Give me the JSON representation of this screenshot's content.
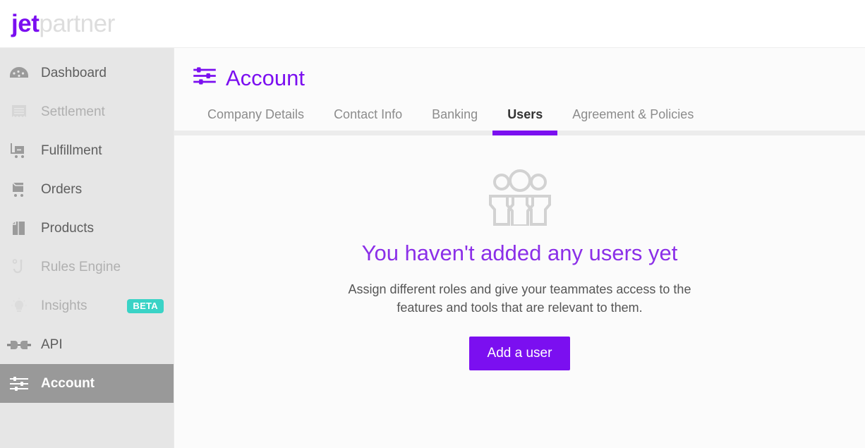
{
  "brand": {
    "logo_primary": "jet",
    "logo_secondary": "partner",
    "primary_color": "#7b0ff0",
    "secondary_color": "#dddddd"
  },
  "sidebar": {
    "background_color": "#e6e6e6",
    "active_color": "#999999",
    "items": [
      {
        "label": "Dashboard",
        "icon": "gauge-icon",
        "state": "normal",
        "badge": null
      },
      {
        "label": "Settlement",
        "icon": "receipt-icon",
        "state": "disabled",
        "badge": null
      },
      {
        "label": "Fulfillment",
        "icon": "cart-out-icon",
        "state": "normal",
        "badge": null
      },
      {
        "label": "Orders",
        "icon": "cart-icon",
        "state": "normal",
        "badge": null
      },
      {
        "label": "Products",
        "icon": "box-icon",
        "state": "normal",
        "badge": null
      },
      {
        "label": "Rules Engine",
        "icon": "rules-icon",
        "state": "disabled",
        "badge": null
      },
      {
        "label": "Insights",
        "icon": "lightbulb-icon",
        "state": "disabled",
        "badge": "BETA"
      },
      {
        "label": "API",
        "icon": "plug-icon",
        "state": "normal",
        "badge": null
      },
      {
        "label": "Account",
        "icon": "sliders-icon",
        "state": "active",
        "badge": null
      }
    ],
    "badge_color": "#3ad3c6"
  },
  "page": {
    "title": "Account",
    "title_icon": "sliders-icon",
    "title_color": "#7b0ff0"
  },
  "tabs": [
    {
      "label": "Company Details",
      "active": false
    },
    {
      "label": "Contact Info",
      "active": false
    },
    {
      "label": "Banking",
      "active": false
    },
    {
      "label": "Users",
      "active": true
    },
    {
      "label": "Agreement & Policies",
      "active": false
    }
  ],
  "empty_state": {
    "icon": "three-users-icon",
    "title": "You haven't added any users yet",
    "description": "Assign different roles and give your teammates access to the features and tools that are relevant to them.",
    "button_label": "Add a user",
    "button_color": "#7b0ff0"
  }
}
